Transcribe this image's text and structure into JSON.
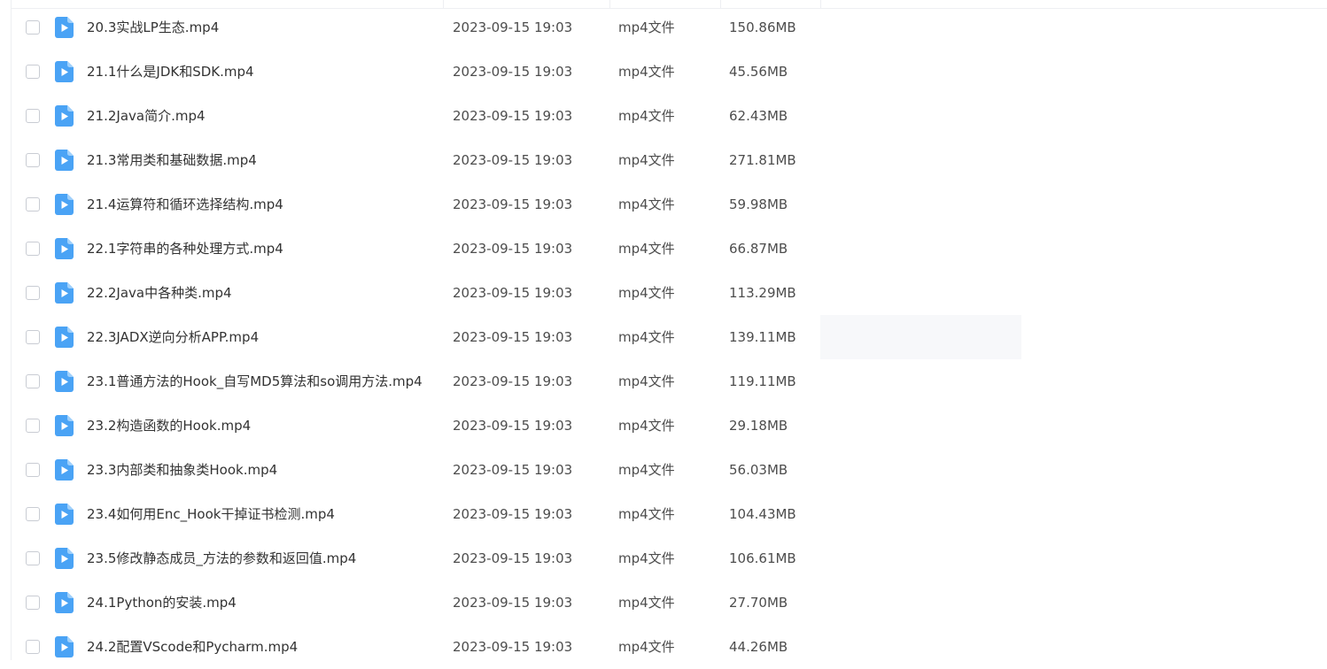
{
  "theme": {
    "icon_blue": "#4aa3f5",
    "hover_bg": "#f7f8fa"
  },
  "files": [
    {
      "name": "20.3实战LP生态.mp4",
      "date": "2023-09-15 19:03",
      "type": "mp4文件",
      "size": "150.86MB",
      "icon": "video-file-icon"
    },
    {
      "name": "21.1什么是JDK和SDK.mp4",
      "date": "2023-09-15 19:03",
      "type": "mp4文件",
      "size": "45.56MB",
      "icon": "video-file-icon"
    },
    {
      "name": "21.2Java简介.mp4",
      "date": "2023-09-15 19:03",
      "type": "mp4文件",
      "size": "62.43MB",
      "icon": "video-file-icon"
    },
    {
      "name": "21.3常用类和基础数据.mp4",
      "date": "2023-09-15 19:03",
      "type": "mp4文件",
      "size": "271.81MB",
      "icon": "video-file-icon"
    },
    {
      "name": "21.4运算符和循环选择结构.mp4",
      "date": "2023-09-15 19:03",
      "type": "mp4文件",
      "size": "59.98MB",
      "icon": "video-file-icon"
    },
    {
      "name": "22.1字符串的各种处理方式.mp4",
      "date": "2023-09-15 19:03",
      "type": "mp4文件",
      "size": "66.87MB",
      "icon": "video-file-icon"
    },
    {
      "name": "22.2Java中各种类.mp4",
      "date": "2023-09-15 19:03",
      "type": "mp4文件",
      "size": "113.29MB",
      "icon": "video-file-icon"
    },
    {
      "name": "22.3JADX逆向分析APP.mp4",
      "date": "2023-09-15 19:03",
      "type": "mp4文件",
      "size": "139.11MB",
      "icon": "video-file-icon",
      "hover": true
    },
    {
      "name": "23.1普通方法的Hook_自写MD5算法和so调用方法.mp4",
      "date": "2023-09-15 19:03",
      "type": "mp4文件",
      "size": "119.11MB",
      "icon": "video-file-icon"
    },
    {
      "name": "23.2构造函数的Hook.mp4",
      "date": "2023-09-15 19:03",
      "type": "mp4文件",
      "size": "29.18MB",
      "icon": "video-file-icon"
    },
    {
      "name": "23.3内部类和抽象类Hook.mp4",
      "date": "2023-09-15 19:03",
      "type": "mp4文件",
      "size": "56.03MB",
      "icon": "video-file-icon"
    },
    {
      "name": "23.4如何用Enc_Hook干掉证书检测.mp4",
      "date": "2023-09-15 19:03",
      "type": "mp4文件",
      "size": "104.43MB",
      "icon": "video-file-icon"
    },
    {
      "name": "23.5修改静态成员_方法的参数和返回值.mp4",
      "date": "2023-09-15 19:03",
      "type": "mp4文件",
      "size": "106.61MB",
      "icon": "video-file-icon"
    },
    {
      "name": "24.1Python的安装.mp4",
      "date": "2023-09-15 19:03",
      "type": "mp4文件",
      "size": "27.70MB",
      "icon": "video-file-icon"
    },
    {
      "name": "24.2配置VScode和Pycharm.mp4",
      "date": "2023-09-15 19:03",
      "type": "mp4文件",
      "size": "44.26MB",
      "icon": "video-file-icon"
    }
  ]
}
